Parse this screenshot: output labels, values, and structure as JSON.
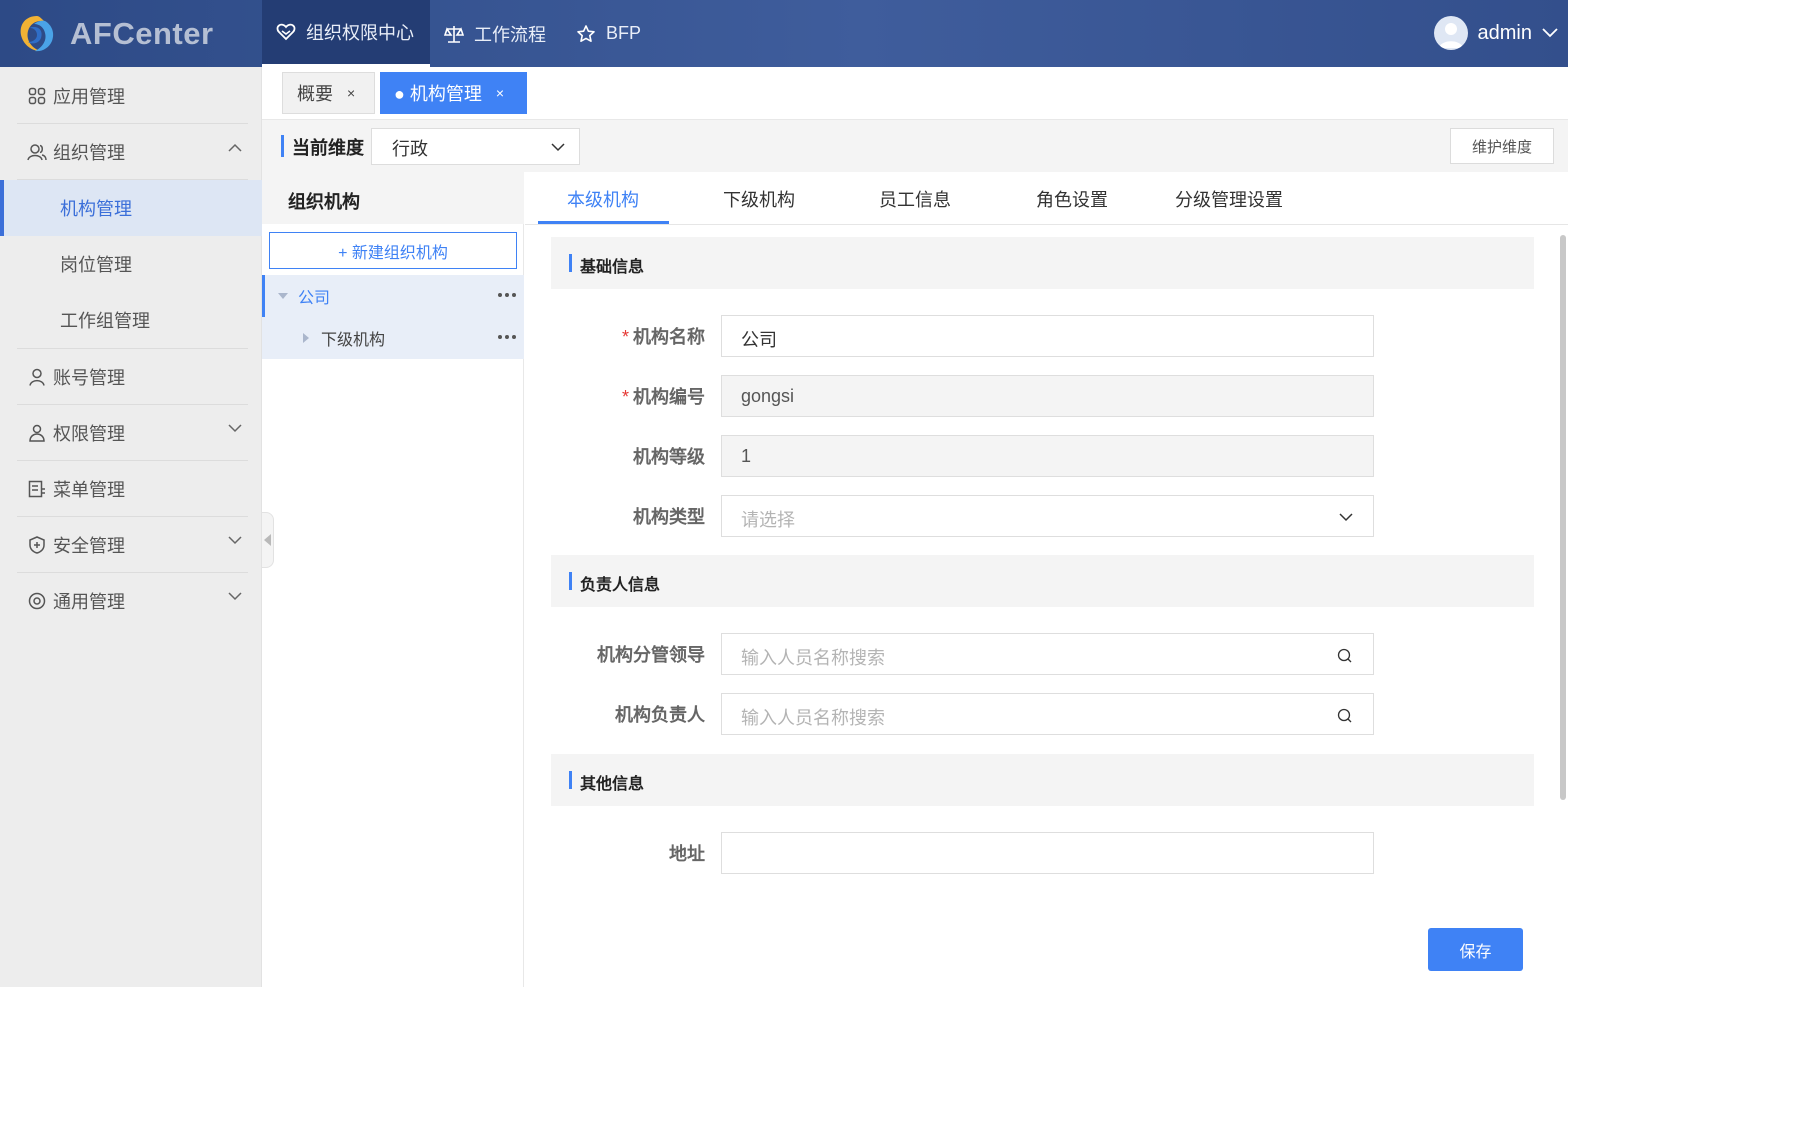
{
  "app": {
    "title": "AFCenter"
  },
  "topnav": {
    "items": [
      {
        "label": "组织权限中心",
        "icon": "heart-shield-icon",
        "active": true
      },
      {
        "label": "工作流程",
        "icon": "scale-icon",
        "active": false
      },
      {
        "label": "BFP",
        "icon": "star-icon",
        "active": false
      }
    ],
    "user": {
      "name": "admin"
    }
  },
  "sidebar": {
    "items": [
      {
        "label": "应用管理",
        "icon": "grid-icon"
      },
      {
        "label": "组织管理",
        "icon": "users-icon",
        "expanded": true
      },
      {
        "label": "机构管理",
        "sub": true,
        "active": true
      },
      {
        "label": "岗位管理",
        "sub": true
      },
      {
        "label": "工作组管理",
        "sub": true
      },
      {
        "label": "账号管理",
        "icon": "user-icon"
      },
      {
        "label": "权限管理",
        "icon": "user-lock-icon"
      },
      {
        "label": "菜单管理",
        "icon": "menu-doc-icon"
      },
      {
        "label": "安全管理",
        "icon": "shield-plus-icon"
      },
      {
        "label": "通用管理",
        "icon": "target-icon"
      }
    ]
  },
  "pagetabs": [
    {
      "label": "概要",
      "close": "×",
      "active": false
    },
    {
      "label": "● 机构管理",
      "close": "×",
      "active": true
    }
  ],
  "dimension": {
    "label": "当前维度",
    "value": "行政",
    "maintain_label": "维护维度"
  },
  "tree": {
    "title": "组织机构",
    "new_label": "+ 新建组织机构",
    "nodes": [
      {
        "label": "公司",
        "level": 0,
        "expanded": true
      },
      {
        "label": "下级机构",
        "level": 1,
        "expanded": false
      }
    ]
  },
  "content_tabs": [
    {
      "label": "本级机构",
      "active": true
    },
    {
      "label": "下级机构"
    },
    {
      "label": "员工信息"
    },
    {
      "label": "角色设置"
    },
    {
      "label": "分级管理设置"
    }
  ],
  "form": {
    "sections": {
      "basic": "基础信息",
      "owner": "负责人信息",
      "other": "其他信息"
    },
    "fields": {
      "name": {
        "label": "机构名称",
        "required": true,
        "value": "公司"
      },
      "code": {
        "label": "机构编号",
        "required": true,
        "value": "gongsi"
      },
      "level": {
        "label": "机构等级",
        "value": "1"
      },
      "type": {
        "label": "机构类型",
        "placeholder": "请选择"
      },
      "leader": {
        "label": "机构分管领导",
        "placeholder": "输入人员名称搜索"
      },
      "manager": {
        "label": "机构负责人",
        "placeholder": "输入人员名称搜索"
      },
      "address": {
        "label": "地址",
        "value": ""
      }
    },
    "required_mark": "*",
    "save_label": "保存"
  },
  "colors": {
    "primary": "#3f82f5",
    "header": "#2d4a86",
    "sidebar_bg": "#ededed",
    "required": "#e53935"
  }
}
